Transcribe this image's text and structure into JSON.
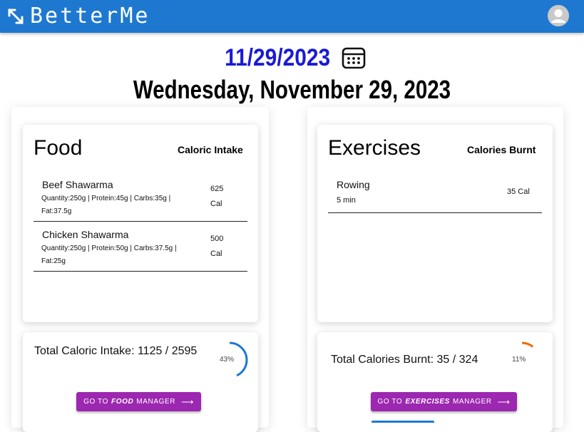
{
  "app": {
    "title": "BetterMe"
  },
  "date": {
    "short": "11/29/2023",
    "long": "Wednesday, November 29, 2023"
  },
  "food": {
    "title": "Food",
    "column_label": "Caloric Intake",
    "items": [
      {
        "name": "Beef Shawarma",
        "detail": "Quantity:250g | Protein:45g | Carbs:35g | Fat:37.5g",
        "cal_value": "625",
        "cal_unit": "Cal"
      },
      {
        "name": "Chicken Shawarma",
        "detail": "Quantity:250g | Protein:50g | Carbs:37.5g | Fat:25g",
        "cal_value": "500",
        "cal_unit": "Cal"
      }
    ],
    "total_text": "Total Caloric Intake: 1125 / 2595",
    "percent": "43%",
    "progress": 0.43,
    "button": {
      "prefix": "GO TO",
      "keyword": "FOOD",
      "suffix": "MANAGER"
    }
  },
  "exercises": {
    "title": "Exercises",
    "column_label": "Calories Burnt",
    "items": [
      {
        "name": "Rowing",
        "duration": "5 min",
        "cal": "35 Cal"
      }
    ],
    "total_text": "Total Calories Burnt: 35 / 324",
    "percent": "11%",
    "progress": 0.11,
    "button": {
      "prefix": "GO TO",
      "keyword": "EXERCISES",
      "suffix": "MANAGER"
    }
  },
  "colors": {
    "appbar": "#1e78d0",
    "date": "#1a1ad6",
    "button": "#9c27b0",
    "food_ring": "#1e78d0",
    "exercise_ring": "#ef6c00"
  },
  "icons": [
    "expand-arrows-icon",
    "account-circle-icon",
    "calendar-icon",
    "arrow-right-icon"
  ]
}
